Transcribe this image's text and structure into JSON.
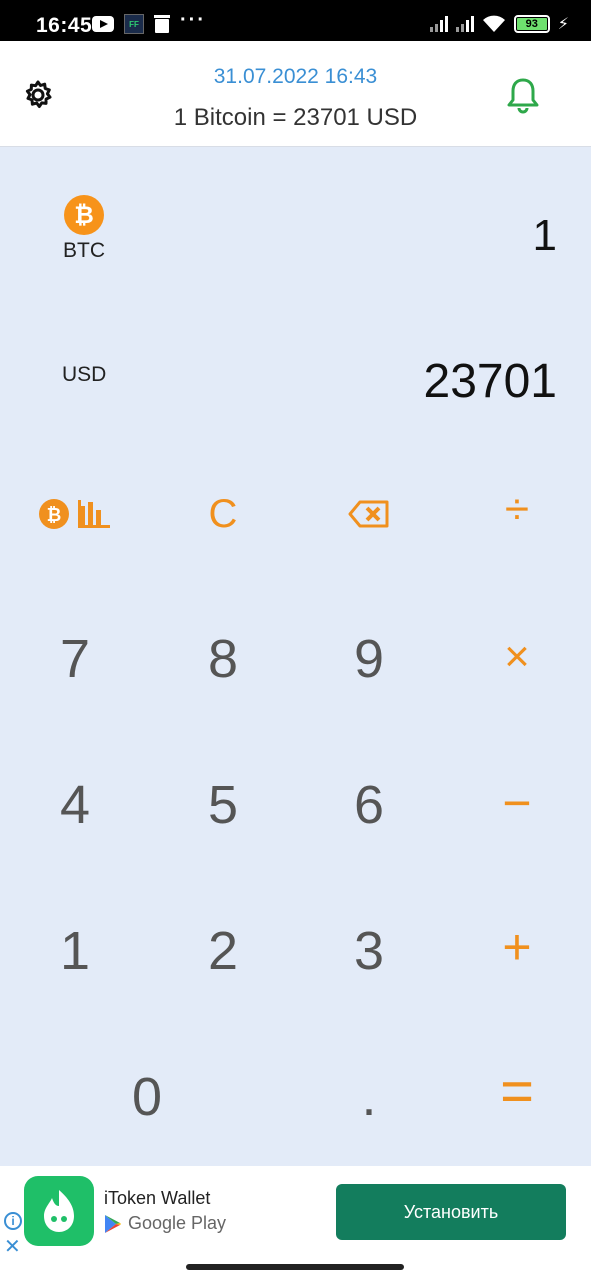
{
  "status_bar": {
    "time": "16:45",
    "ff_label": "FF",
    "more": "···",
    "battery": "93",
    "icons": [
      "youtube-icon",
      "ff-app-icon",
      "trash-icon",
      "signal-icon",
      "signal-icon",
      "wifi-icon",
      "battery-icon",
      "charging-icon"
    ]
  },
  "header": {
    "datetime": "31.07.2022 16:43",
    "rate": "1 Bitcoin = 23701 USD",
    "settings_icon": "gear-icon",
    "alert_icon": "bell-icon",
    "accent": "#3a8fd4",
    "bell_color": "#2ea84a"
  },
  "converter": {
    "from": {
      "code": "BTC",
      "value": "1",
      "icon": "bitcoin-icon"
    },
    "to": {
      "code": "USD",
      "value": "23701"
    }
  },
  "keypad": {
    "accent": "#f0901e",
    "function_keys": {
      "chart_icon": "bitcoin-chart-icon",
      "clear": "C",
      "backspace_icon": "backspace-icon",
      "divide": "÷"
    },
    "rows": [
      [
        "7",
        "8",
        "9",
        "×"
      ],
      [
        "4",
        "5",
        "6",
        "−"
      ],
      [
        "1",
        "2",
        "3",
        "+"
      ]
    ],
    "bottom": {
      "zero": "0",
      "dot": ".",
      "equals": "="
    }
  },
  "ad": {
    "title": "iToken Wallet",
    "store": "Google Play",
    "button": "Установить",
    "button_color": "#137d5d",
    "info_icon": "info-icon",
    "close_icon": "close-icon"
  }
}
